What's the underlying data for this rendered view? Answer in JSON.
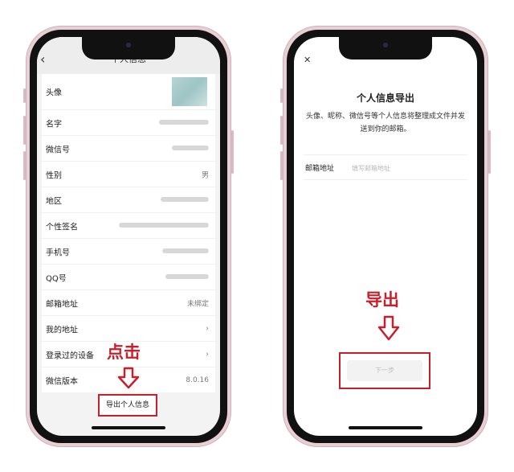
{
  "left_screen": {
    "title": "个人信息",
    "back_icon": "chevron-left-icon",
    "rows": [
      {
        "label": "头像",
        "value": ""
      },
      {
        "label": "名字",
        "value": ""
      },
      {
        "label": "微信号",
        "value": ""
      },
      {
        "label": "性别",
        "value": "男"
      },
      {
        "label": "地区",
        "value": ""
      },
      {
        "label": "个性签名",
        "value": ""
      },
      {
        "label": "手机号",
        "value": ""
      },
      {
        "label": "QQ号",
        "value": ""
      },
      {
        "label": "邮箱地址",
        "value": "未绑定"
      },
      {
        "label": "我的地址",
        "value": ""
      },
      {
        "label": "登录过的设备",
        "value": ""
      },
      {
        "label": "微信版本",
        "value": "8.0.16"
      }
    ],
    "export_button": "导出个人信息",
    "annotation": "点击",
    "annotation_color": "#c81f2b"
  },
  "right_screen": {
    "close_icon": "close-icon",
    "title": "个人信息导出",
    "description": "头像、昵称、微信号等个人信息将整理成文件并发送到你的邮箱。",
    "email_label": "邮箱地址",
    "email_placeholder": "填写邮箱地址",
    "next_button": "下一步",
    "annotation": "导出",
    "annotation_color": "#c81f2b"
  }
}
